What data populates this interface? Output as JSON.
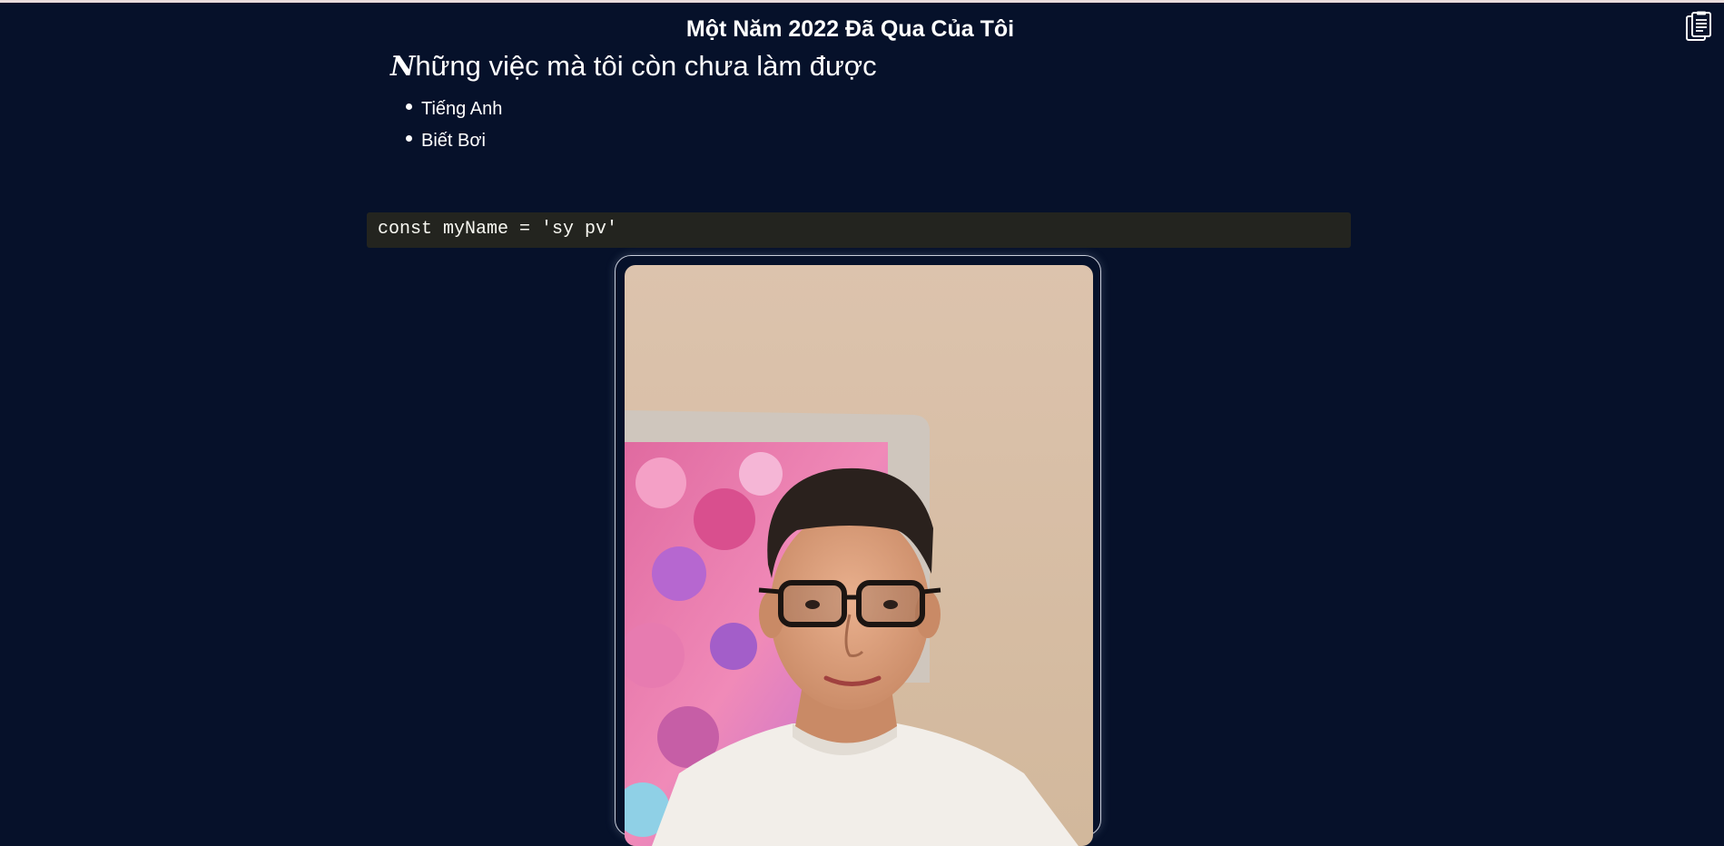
{
  "page": {
    "title": "Một Năm 2022 Đã Qua Của Tôi",
    "background": "#06112a"
  },
  "section": {
    "heading_initial": "N",
    "heading_rest": "hững việc mà tôi còn chưa làm được",
    "items": [
      {
        "label": "Tiếng Anh"
      },
      {
        "label": "Biết Bơi"
      }
    ]
  },
  "code": {
    "text": "const myName = 'sy pv'",
    "background": "#23241f"
  },
  "icons": {
    "clipboard": "clipboard-icon"
  }
}
